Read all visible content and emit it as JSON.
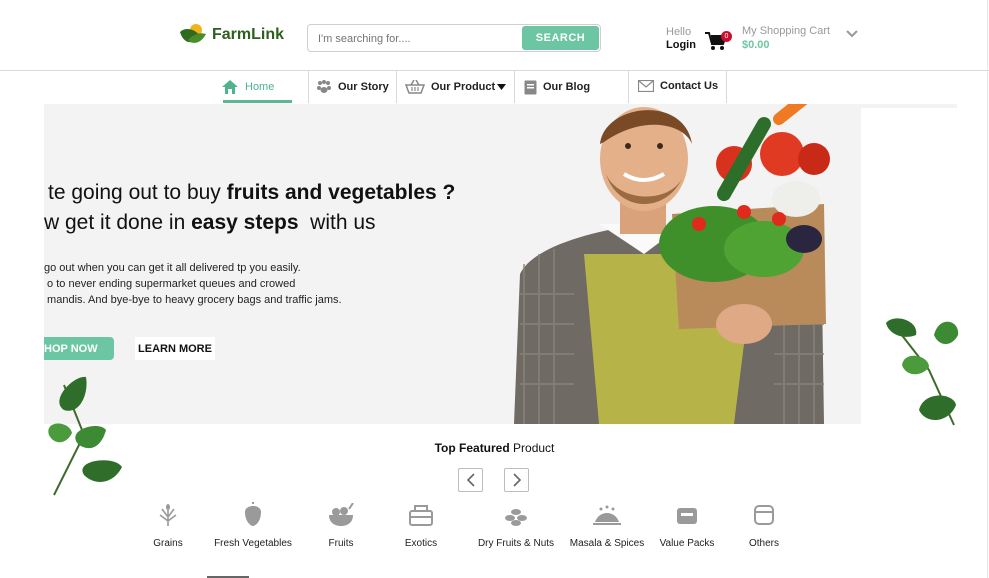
{
  "header": {
    "logo_text": "FarmLink",
    "search": {
      "placeholder": "I'm searching for....",
      "button_label": "SEARCH"
    },
    "account": {
      "greeting": "Hello",
      "login_label": "Login"
    },
    "cart": {
      "badge_count": "0",
      "title": "My Shopping Cart",
      "amount": "$0.00"
    }
  },
  "nav": {
    "items": [
      {
        "label": "Home",
        "icon": "home-icon"
      },
      {
        "label": "Our Story",
        "icon": "paw-icon"
      },
      {
        "label": "Our Product",
        "icon": "basket-icon"
      },
      {
        "label": "Our Blog",
        "icon": "document-icon"
      },
      {
        "label": "Contact Us",
        "icon": "envelope-icon"
      }
    ]
  },
  "hero": {
    "line1_pre": "te going out to buy ",
    "line1_bold": "fruits and vegetables ?",
    "line2_pre": "w get it done in ",
    "line2_bold": "easy steps",
    "line2_post": "  with us",
    "para": [
      "go out when you can get it all delivered tp you easily.",
      " o to never ending supermarket queues and crowed",
      " mandis. And bye-bye to heavy grocery bags and traffic jams."
    ],
    "shop_label": "HOP NOW",
    "learn_label": "LEARN MORE"
  },
  "featured": {
    "title_bold": "Top Featured",
    "title_rest": " Product",
    "categories": [
      {
        "label": "Grains",
        "icon": "grains-icon"
      },
      {
        "label": "Fresh Vegetables",
        "icon": "vegetables-icon"
      },
      {
        "label": "Fruits",
        "icon": "fruits-icon"
      },
      {
        "label": "Exotics",
        "icon": "exotics-icon"
      },
      {
        "label": "Dry Fruits & Nuts",
        "icon": "dry-fruits-icon"
      },
      {
        "label": "Masala & Spices",
        "icon": "spices-icon"
      },
      {
        "label": "Value Packs",
        "icon": "value-pack-icon"
      },
      {
        "label": "Others",
        "icon": "others-icon"
      }
    ]
  },
  "colors": {
    "accent": "#6cc6a3",
    "logo_green": "#2f5f1e",
    "badge_red": "#c8102e"
  }
}
